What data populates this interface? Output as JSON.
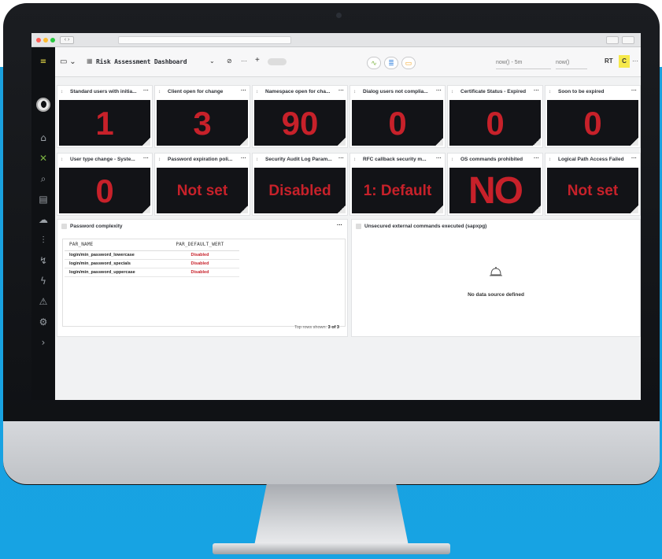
{
  "app": {
    "dashboard_title": "Risk Assessment Dashboard",
    "time_from": "now() - 5m",
    "time_to": "now()",
    "refresh_mode": "RT",
    "ellipsis": "···"
  },
  "colors": {
    "accent_green": "#7cb342",
    "alert_red": "#c7212a",
    "tile_bg": "#121317",
    "highlight_yellow": "#f6e94b"
  },
  "panels_row1": [
    {
      "title": "Standard users with initia...",
      "value": "1",
      "color": "red"
    },
    {
      "title": "Client open for change",
      "value": "3",
      "color": "red"
    },
    {
      "title": "Namespace open for cha...",
      "value": "90",
      "color": "red"
    },
    {
      "title": "Dialog users not complia...",
      "value": "0",
      "color": "green"
    },
    {
      "title": "Certificate Status - Expired",
      "value": "0",
      "color": "green"
    },
    {
      "title": "Soon to be expired",
      "value": "0",
      "color": "green"
    }
  ],
  "panels_row2": [
    {
      "title": "User type change - Syste...",
      "value": "0",
      "color": "green"
    },
    {
      "title": "Password expiration poli...",
      "value": "Not set",
      "color": "red"
    },
    {
      "title": "Security Audit Log Param...",
      "value": "Disabled",
      "color": "red"
    },
    {
      "title": "RFC callback security m...",
      "value": "1: Default",
      "color": "green"
    },
    {
      "title": "OS commands prohibited",
      "value": "NO",
      "color": "red"
    },
    {
      "title": "Logical Path Access Failed",
      "value": "Not set",
      "color": "red"
    }
  ],
  "password_panel": {
    "title": "Password complexity",
    "columns": [
      "PAR_NAME",
      "PAR_DEFAULT_WERT"
    ],
    "rows": [
      [
        "login/min_password_lowercase",
        "Disabled"
      ],
      [
        "login/min_password_specials",
        "Disabled"
      ],
      [
        "login/min_password_uppercase",
        "Disabled"
      ]
    ],
    "footer_label": "Top rows shown:",
    "footer_value": "3 of 3"
  },
  "commands_panel": {
    "title": "Unsecured external commands executed (sapxpg)",
    "empty_text": "No data source defined"
  }
}
